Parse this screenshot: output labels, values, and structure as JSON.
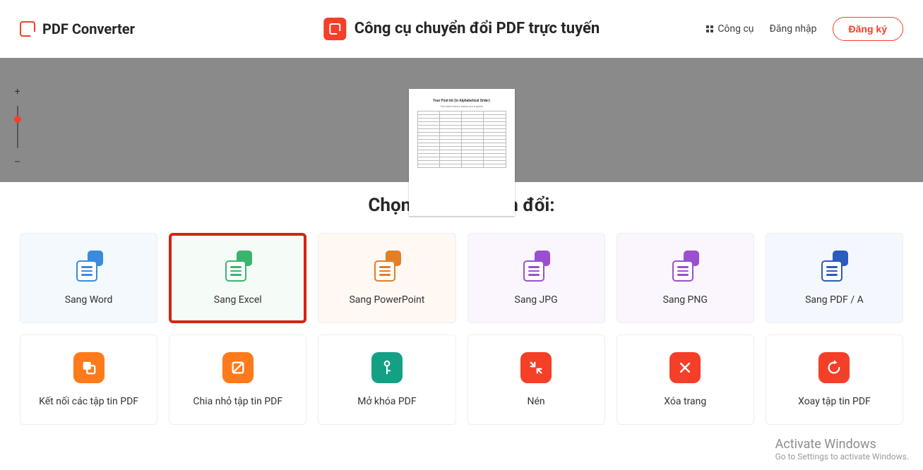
{
  "brand": {
    "name": "PDF Converter"
  },
  "header_title": "Công cụ chuyển đổi PDF trực tuyến",
  "nav": {
    "tools": "Công cụ",
    "login": "Đăng nhập",
    "signup": "Đăng ký"
  },
  "zoom": {
    "plus": "+",
    "minus": "–"
  },
  "doc_preview": {
    "heading": "Your First kit (In Alphabetical Order)",
    "subheading": "The listed items below are a guide"
  },
  "section_title": "Chọn trình chuyển đổi:",
  "converters_row1": [
    {
      "key": "word",
      "label": "Sang Word",
      "color": "#3a8bdc"
    },
    {
      "key": "excel",
      "label": "Sang Excel",
      "color": "#3bb46d"
    },
    {
      "key": "ppt",
      "label": "Sang PowerPoint",
      "color": "#e57d23"
    },
    {
      "key": "jpg",
      "label": "Sang JPG",
      "color": "#9b4fcf"
    },
    {
      "key": "png",
      "label": "Sang PNG",
      "color": "#9b4fcf"
    },
    {
      "key": "pdfa",
      "label": "Sang PDF / A",
      "color": "#2a5bbf"
    }
  ],
  "converters_row2": [
    {
      "key": "merge",
      "label": "Kết nối các tập tin PDF",
      "icon": "merge",
      "color": "orange"
    },
    {
      "key": "split",
      "label": "Chia nhỏ tập tin PDF",
      "icon": "split",
      "color": "orange"
    },
    {
      "key": "unlock",
      "label": "Mở khóa PDF",
      "icon": "key",
      "color": "teal"
    },
    {
      "key": "compress",
      "label": "Nén",
      "icon": "compress",
      "color": "red"
    },
    {
      "key": "delete",
      "label": "Xóa trang",
      "icon": "close",
      "color": "red"
    },
    {
      "key": "rotate",
      "label": "Xoay tập tin PDF",
      "icon": "rotate",
      "color": "red"
    }
  ],
  "selected_converter": "excel",
  "watermark": {
    "title": "Activate Windows",
    "sub": "Go to Settings to activate Windows."
  }
}
